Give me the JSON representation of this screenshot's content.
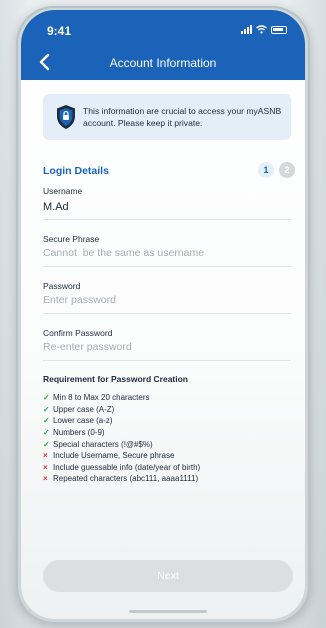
{
  "status_bar": {
    "time": "9:41"
  },
  "header": {
    "title": "Account Information"
  },
  "info_banner": {
    "text": "This information are crucial to access your myASNB account. Please keep it private."
  },
  "section": {
    "title": "Login Details",
    "steps": [
      "1",
      "2"
    ]
  },
  "fields": {
    "username": {
      "label": "Username",
      "value": "M.Ad"
    },
    "secure_phrase": {
      "label": "Secure Phrase",
      "placeholder": "Cannot  be the same as username"
    },
    "password": {
      "label": "Password",
      "placeholder": "Enter password"
    },
    "confirm_password": {
      "label": "Confirm Password",
      "placeholder": "Re-enter password"
    }
  },
  "requirements": {
    "title": "Requirement for Password Creation",
    "items": [
      {
        "text": "Min 8 to Max 20 characters",
        "status": "pass"
      },
      {
        "text": "Upper case (A-Z)",
        "status": "pass"
      },
      {
        "text": "Lower case (a-z)",
        "status": "pass"
      },
      {
        "text": "Numbers (0-9)",
        "status": "pass"
      },
      {
        "text": "Special characters (!@#$%)",
        "status": "pass"
      },
      {
        "text": "Include Username, Secure phrase",
        "status": "fail"
      },
      {
        "text": "Include guessable info (date/year of birth)",
        "status": "fail"
      },
      {
        "text": "Repeated characters (abc111, aaaa1111)",
        "status": "fail"
      }
    ],
    "pass_mark": "✓",
    "fail_mark": "×"
  },
  "actions": {
    "next_label": "Next"
  },
  "colors": {
    "brand": "#1a63b8",
    "pass": "#2ea84f",
    "fail": "#d8343b",
    "disabled_button": "#dcdfe1"
  }
}
